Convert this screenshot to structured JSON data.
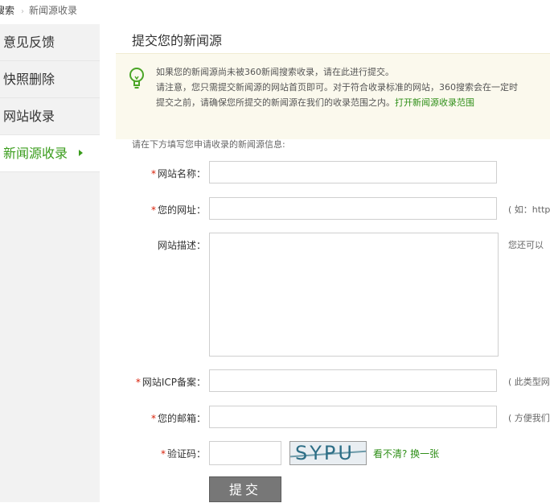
{
  "breadcrumb": {
    "home": "搜索",
    "separator": "›",
    "current": "新闻源收录"
  },
  "sidebar": {
    "items": [
      {
        "label": "意见反馈"
      },
      {
        "label": "快照删除"
      },
      {
        "label": "网站收录"
      },
      {
        "label": "新闻源收录"
      }
    ]
  },
  "main": {
    "title": "提交您的新闻源",
    "notice": {
      "line1": "如果您的新闻源尚未被360新闻搜索收录，请在此进行提交。",
      "line2": "请注意，您只需提交新闻源的网站首页即可。对于符合收录标准的网站，360搜索会在一定时",
      "line3": "提交之前，请确保您所提交的新闻源在我们的收录范围之内。",
      "link": "打开新闻源收录范围"
    },
    "form_intro": "请在下方填写您申请收录的新闻源信息:",
    "fields": {
      "site_name_label": "网站名称：",
      "url_label": "您的网址：",
      "url_hint": "( 如：http",
      "desc_label": "网站描述：",
      "desc_hint": "您还可以",
      "icp_label": "网站ICP备案：",
      "icp_hint": "( 此类型网",
      "email_label": "您的邮箱：",
      "email_hint": "( 方便我们",
      "captcha_label": "验证码：",
      "captcha_text": "SYPU",
      "captcha_refresh": "看不清? 换一张",
      "required_mark": "*"
    },
    "submit_label": "提交"
  }
}
